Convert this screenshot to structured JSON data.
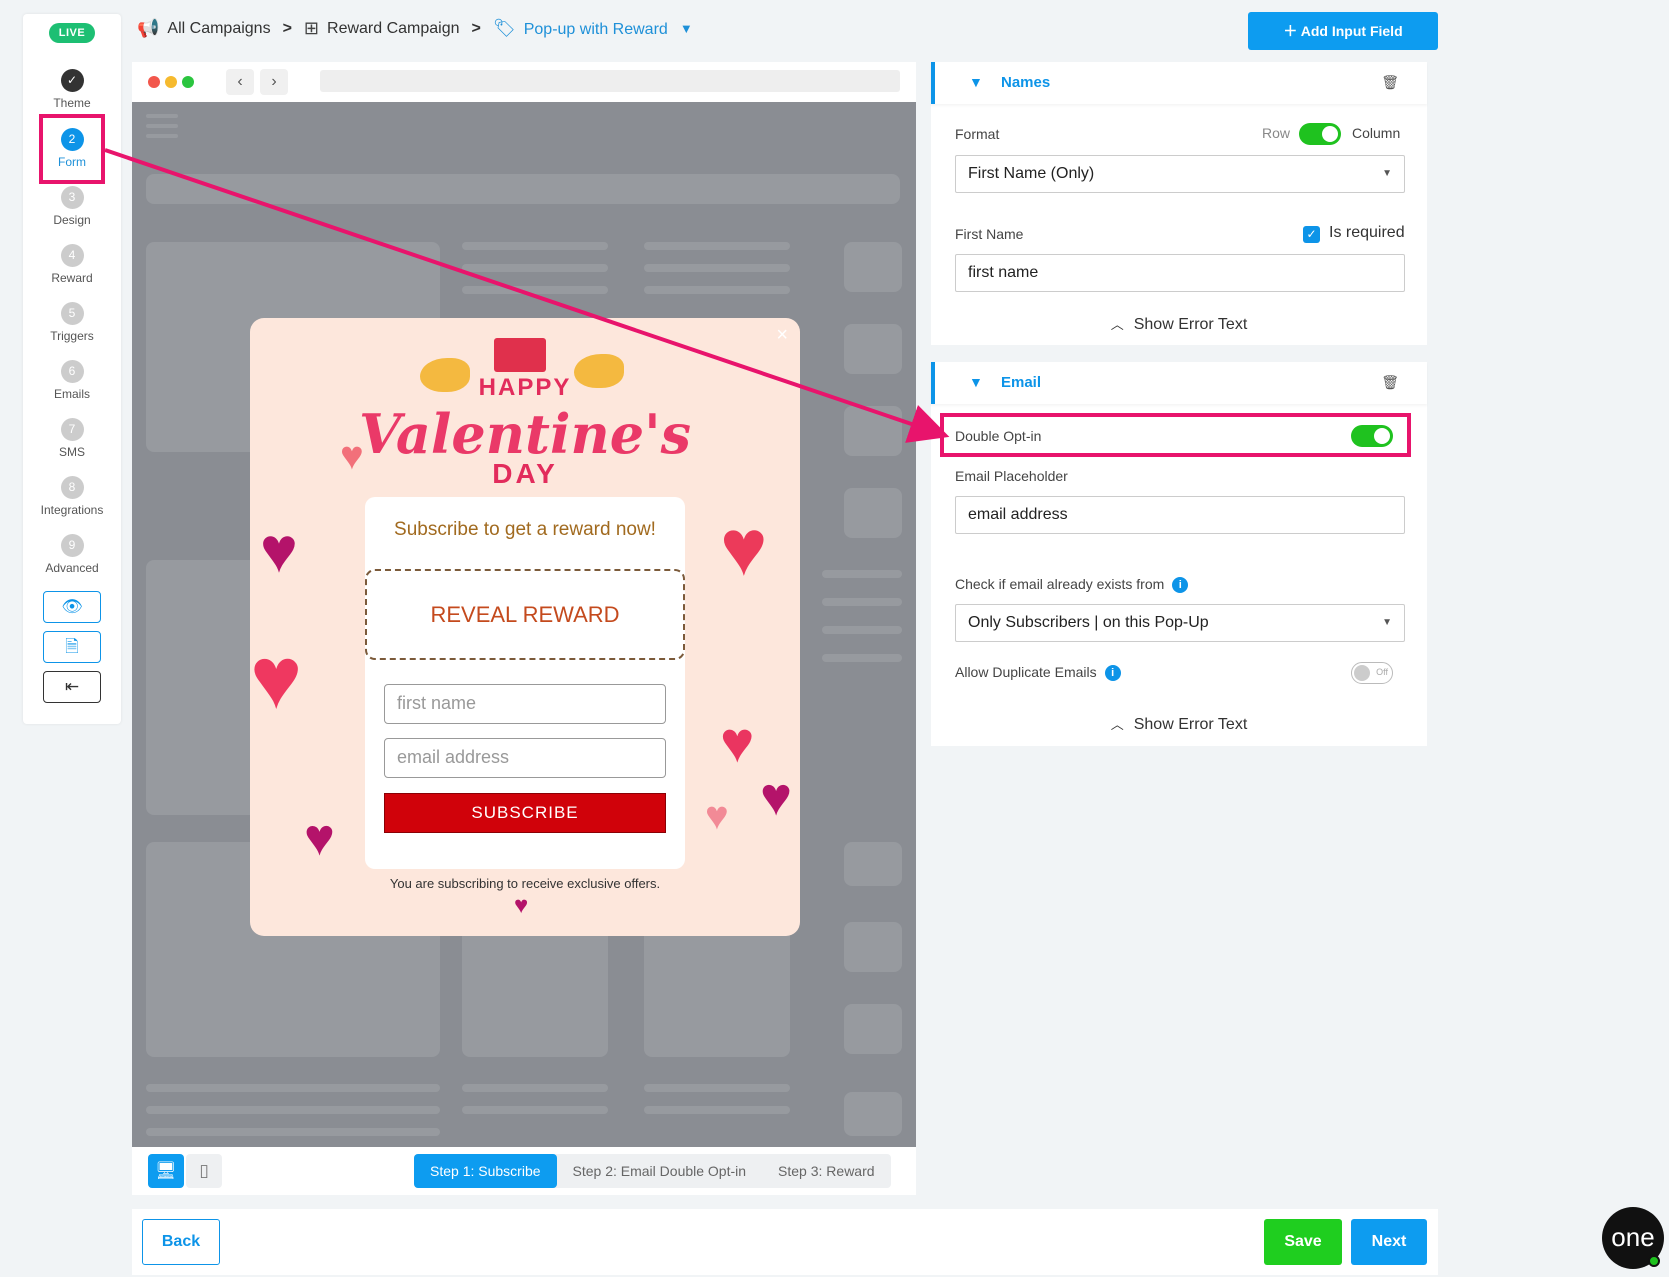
{
  "rail": {
    "live_badge": "LIVE",
    "steps": [
      {
        "num": "✓",
        "label": "Theme"
      },
      {
        "num": "2",
        "label": "Form"
      },
      {
        "num": "3",
        "label": "Design"
      },
      {
        "num": "4",
        "label": "Reward"
      },
      {
        "num": "5",
        "label": "Triggers"
      },
      {
        "num": "6",
        "label": "Emails"
      },
      {
        "num": "7",
        "label": "SMS"
      },
      {
        "num": "8",
        "label": "Integrations"
      },
      {
        "num": "9",
        "label": "Advanced"
      }
    ],
    "active_step": "Form"
  },
  "breadcrumb": {
    "item1": "All Campaigns",
    "item2": "Reward Campaign",
    "item3": "Pop-up with Reward",
    "separator": ">"
  },
  "add_input_field": "Add Input Field",
  "popup": {
    "happy": "HAPPY",
    "valentine": "Valentine's",
    "day": "DAY",
    "headline": "Subscribe to get a reward now!",
    "reveal": "REVEAL REWARD",
    "first_name_placeholder": "first name",
    "email_placeholder": "email address",
    "subscribe": "SUBSCRIBE",
    "footer": "You are subscribing to receive exclusive offers."
  },
  "steps_tabs": [
    "Step 1: Subscribe",
    "Step 2: Email Double Opt-in",
    "Step 3: Reward"
  ],
  "names_panel": {
    "title": "Names",
    "format_label": "Format",
    "row": "Row",
    "column": "Column",
    "format_value": "First Name (Only)",
    "first_name_label": "First Name",
    "is_required": "Is required",
    "first_name_value": "first name",
    "show_error": "Show Error Text"
  },
  "email_panel": {
    "title": "Email",
    "double_opt_in": "Double Opt-in",
    "placeholder_label": "Email Placeholder",
    "placeholder_value": "email address",
    "check_label": "Check if email already exists from",
    "check_value": "Only Subscribers | on this Pop-Up",
    "allow_dup": "Allow Duplicate Emails",
    "off": "Off",
    "show_error": "Show Error Text"
  },
  "footer": {
    "back": "Back",
    "save": "Save",
    "next": "Next"
  },
  "chat_logo": "one",
  "colors": {
    "accent": "#0d94e8",
    "highlight": "#e8146c",
    "toggle_on": "#1fc21f",
    "subscribe": "#d0020a"
  }
}
